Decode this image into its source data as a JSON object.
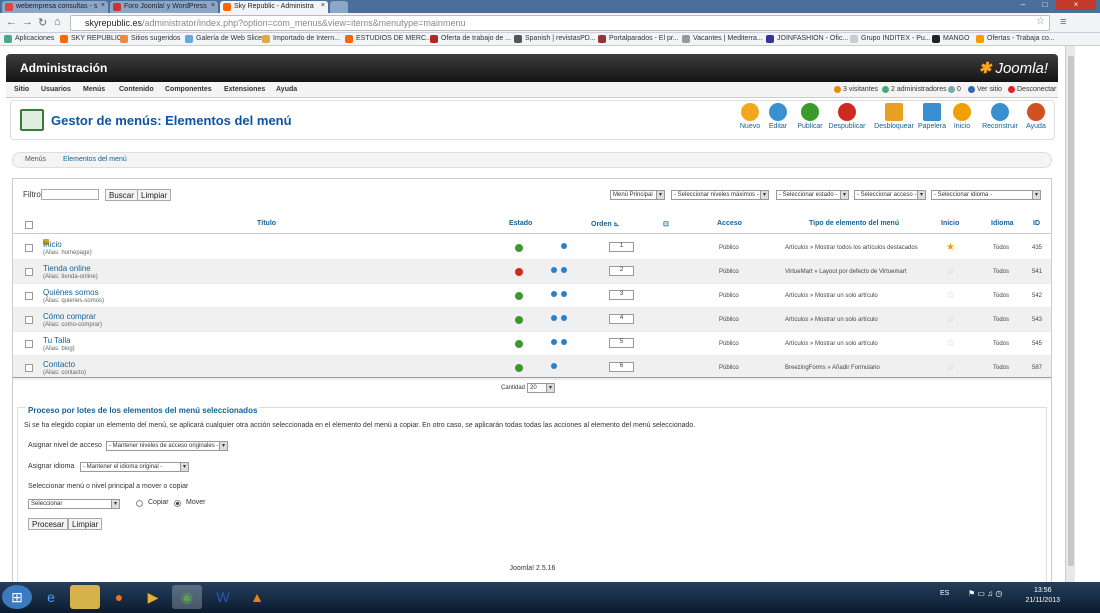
{
  "browser": {
    "tabs": [
      {
        "label": "webempresa consultas - s",
        "color": "#d44"
      },
      {
        "label": "Foro Joomla! y WordPress",
        "color": "#c33"
      },
      {
        "label": "Sky Republic - Administra",
        "color": "#f60"
      }
    ],
    "url_host": "skyrepublic.es",
    "url_path": "/administrator/index.php?option=com_menus&view=items&menutype=mainmenu",
    "bookmarks": [
      {
        "label": "Aplicaciones",
        "color": "#4a8"
      },
      {
        "label": "SKY REPUBLIC",
        "color": "#f60"
      },
      {
        "label": "Sitios sugeridos",
        "color": "#e84"
      },
      {
        "label": "Galería de Web Slice",
        "color": "#6ad"
      },
      {
        "label": "Importado de Intern...",
        "color": "#da4"
      },
      {
        "label": "ESTUDIOS DE MERC...",
        "color": "#f60"
      },
      {
        "label": "Oferta de trabajo de ...",
        "color": "#b22"
      },
      {
        "label": "Spanish | revistasPD...",
        "color": "#555"
      },
      {
        "label": "Portalparados - El pr...",
        "color": "#933"
      },
      {
        "label": "Vacantes | Mediterra...",
        "color": "#999"
      },
      {
        "label": "JOINFASHION - Ofic...",
        "color": "#339"
      },
      {
        "label": "Grupo INDITEX - Pu...",
        "color": "#ccc"
      },
      {
        "label": "MANGO",
        "color": "#222"
      },
      {
        "label": "Ofertas - Trabaja co...",
        "color": "#f90"
      }
    ]
  },
  "header": {
    "title": "Administración",
    "logo": "Joomla!"
  },
  "menubar": {
    "items": [
      "Sitio",
      "Usuarios",
      "Menús",
      "Contenido",
      "Componentes",
      "Extensiones",
      "Ayuda"
    ],
    "status": [
      {
        "label": "3 visitantes",
        "color": "#e88a00"
      },
      {
        "label": "2 administradores",
        "color": "#4a7"
      },
      {
        "label": "0",
        "color": "#7aa"
      },
      {
        "label": "Ver sitio",
        "color": "#36a"
      },
      {
        "label": "Desconectar",
        "color": "#d22"
      }
    ]
  },
  "toolbar": {
    "title": "Gestor de menús: Elementos del menú",
    "buttons": [
      {
        "label": "Nuevo",
        "color": "#f2a81e"
      },
      {
        "label": "Editar",
        "color": "#3a8fd0"
      },
      {
        "label": "Publicar",
        "color": "#3a9a2a"
      },
      {
        "label": "Despublicar",
        "color": "#d02a1e"
      },
      {
        "label": "Desbloquear",
        "color": "#e8a020"
      },
      {
        "label": "Papelera",
        "color": "#3a8fd0"
      },
      {
        "label": "Inicio",
        "color": "#f0a000"
      },
      {
        "label": "Reconstruir",
        "color": "#3a8fd0"
      },
      {
        "label": "Ayuda",
        "color": "#d05020"
      }
    ]
  },
  "subnav": {
    "items": [
      "Menús",
      "Elementos del menú"
    ]
  },
  "filter": {
    "label": "Filtro:",
    "search_button": "Buscar",
    "clear_button": "Limpiar",
    "selects": [
      "Menú Principal",
      "- Seleccionar niveles máximos -",
      "- Seleccionar estado -",
      "- Seleccionar acceso -",
      "- Seleccionar idioma -"
    ]
  },
  "table": {
    "headers": {
      "title": "Título",
      "estado": "Estado",
      "orden": "Orden",
      "acceso": "Acceso",
      "tipo": "Tipo de elemento del menú",
      "inicio": "Inicio",
      "idioma": "Idioma",
      "id": "ID"
    },
    "rows": [
      {
        "title": "Inicio",
        "alias": "(Alias: homepage)",
        "published": true,
        "locked": true,
        "arrows": [
          "down"
        ],
        "order": "1",
        "access": "Público",
        "type": "Artículos » Mostrar todos los artículos destacados",
        "home": true,
        "language": "Todos",
        "id": "435"
      },
      {
        "title": "Tienda online",
        "alias": "(Alias: tienda-online)",
        "published": false,
        "locked": false,
        "arrows": [
          "up",
          "down"
        ],
        "order": "2",
        "access": "Público",
        "type": "VirtueMart » Layout por defecto de Virtuemart",
        "home": false,
        "language": "Todos",
        "id": "541"
      },
      {
        "title": "Quiénes somos",
        "alias": "(Alias: quienes-somos)",
        "published": true,
        "locked": false,
        "arrows": [
          "up",
          "down"
        ],
        "order": "3",
        "access": "Público",
        "type": "Artículos » Mostrar un solo artículo",
        "home": false,
        "language": "Todos",
        "id": "542"
      },
      {
        "title": "Cómo comprar",
        "alias": "(Alias: como-comprar)",
        "published": true,
        "locked": false,
        "arrows": [
          "up",
          "down"
        ],
        "order": "4",
        "access": "Público",
        "type": "Artículos » Mostrar un solo artículo",
        "home": false,
        "language": "Todos",
        "id": "543"
      },
      {
        "title": "Tu Talla",
        "alias": "(Alias: blog)",
        "published": true,
        "locked": false,
        "arrows": [
          "up",
          "down"
        ],
        "order": "5",
        "access": "Público",
        "type": "Artículos » Mostrar un solo artículo",
        "home": false,
        "language": "Todos",
        "id": "545"
      },
      {
        "title": "Contacto",
        "alias": "(Alias: contacto)",
        "published": true,
        "locked": false,
        "arrows": [
          "up"
        ],
        "order": "6",
        "access": "Público",
        "type": "BreezingForms » Añadir Formulario",
        "home": false,
        "language": "Todos",
        "id": "587"
      }
    ],
    "cantidad_label": "Cantidad",
    "cantidad_value": "20"
  },
  "batch": {
    "legend": "Proceso por lotes de los elementos del menú seleccionados",
    "note": "Si se ha elegido copiar un elemento del menú, se aplicará cualquier otra acción seleccionada en el elemento del menú a copiar. En otro caso, se aplicarán todas todas las acciones al elemento del menú seleccionado.",
    "access_label": "Asignar nivel de acceso",
    "access_value": "- Mantener niveles de acceso originales -",
    "language_label": "Asignar idioma",
    "language_value": "- Mantener el idioma original -",
    "move_label": "Seleccionar menú o nivel principal a mover o copiar",
    "move_value": "Seleccionar",
    "copy_label": "Copiar",
    "move_option": "Mover",
    "process_button": "Procesar",
    "clear_button": "Limpiar"
  },
  "footer": {
    "version": "Joomla! 2.5.16"
  },
  "taskbar": {
    "language": "ES",
    "time": "13:56",
    "date": "21/11/2013"
  }
}
